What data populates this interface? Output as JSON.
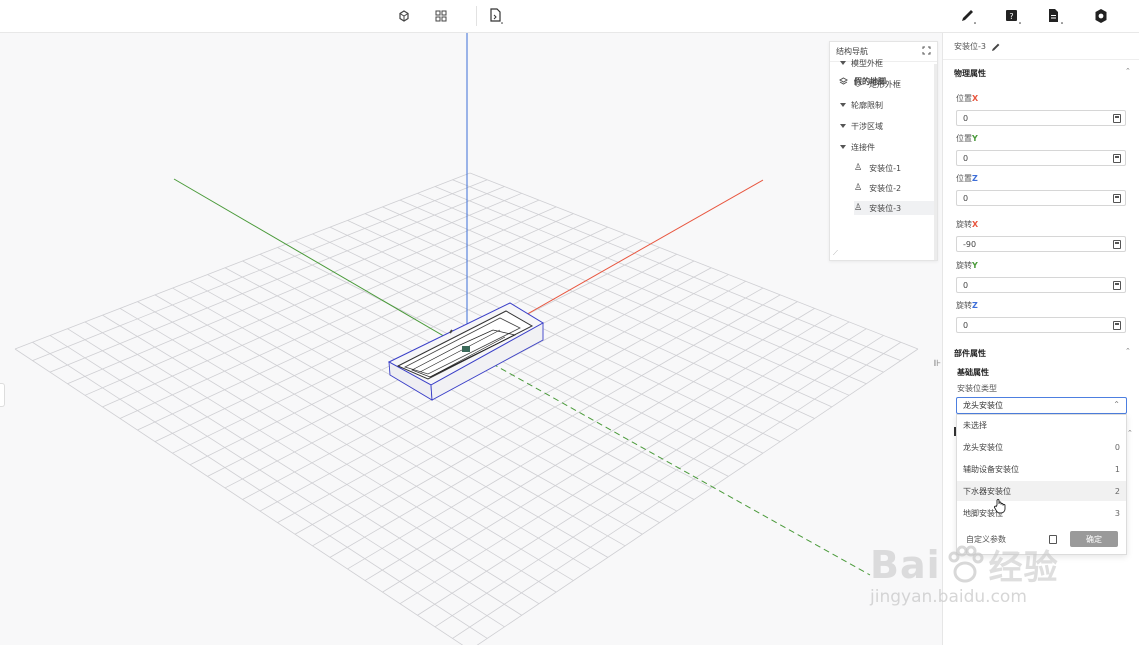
{
  "toolbar": {
    "icons": [
      "cube-toggle-icon",
      "grid-icon",
      "file-export-icon",
      "pencil-icon",
      "help-icon",
      "document-icon",
      "settings-icon"
    ]
  },
  "tree": {
    "title": "结构导航",
    "root": "假的地脚",
    "items": [
      {
        "label": "模型外框",
        "type": "group"
      },
      {
        "label": "矩形外框",
        "type": "child"
      },
      {
        "label": "轮廓限制",
        "type": "group"
      },
      {
        "label": "干涉区域",
        "type": "group"
      },
      {
        "label": "连接件",
        "type": "group"
      },
      {
        "label": "安装位-1",
        "type": "child"
      },
      {
        "label": "安装位-2",
        "type": "child"
      },
      {
        "label": "安装位-3",
        "type": "child"
      }
    ]
  },
  "panel": {
    "title": "安装位-3",
    "physical_section": "物理属性",
    "fields": [
      {
        "label": "位置",
        "axis": "X",
        "value": "0"
      },
      {
        "label": "位置",
        "axis": "Y",
        "value": "0"
      },
      {
        "label": "位置",
        "axis": "Z",
        "value": "0"
      },
      {
        "label": "旋转",
        "axis": "X",
        "value": "-90"
      },
      {
        "label": "旋转",
        "axis": "Y",
        "value": "0"
      },
      {
        "label": "旋转",
        "axis": "Z",
        "value": "0"
      }
    ],
    "part_section": "部件属性",
    "basic_section": "基础属性",
    "type_label": "安装位类型",
    "selected_type": "龙头安装位",
    "options": [
      {
        "label": "未选择",
        "value": ""
      },
      {
        "label": "龙头安装位",
        "value": "0"
      },
      {
        "label": "辅助设备安装位",
        "value": "1"
      },
      {
        "label": "下水器安装位",
        "value": "2"
      },
      {
        "label": "地脚安装位",
        "value": "3"
      }
    ],
    "custom_param_label": "自定义参数",
    "confirm_label": "确定"
  },
  "watermark": {
    "brand": "Bai",
    "brand_cn": "经验",
    "url": "jingyan.baidu.com"
  },
  "colors": {
    "axis_x": "#e8553e",
    "axis_y": "#4a9a3a",
    "axis_z": "#3d6ed8",
    "focus": "#4d7fe0"
  }
}
